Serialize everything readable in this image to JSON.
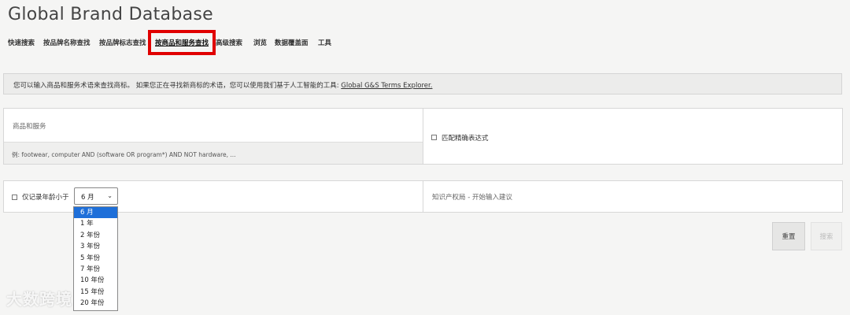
{
  "app_title": "Global Brand Database",
  "nav": {
    "items": [
      {
        "label": "快速搜索",
        "active": false
      },
      {
        "label": "按品牌名称查找",
        "active": false
      },
      {
        "label": "按品牌标志查找",
        "active": false
      },
      {
        "label": "按商品和服务查找",
        "active": true
      },
      {
        "label": "高级搜索",
        "active": false
      },
      {
        "label": "浏览",
        "active": false
      },
      {
        "label": "数据覆盖面",
        "active": false
      },
      {
        "label": "工具",
        "active": false
      }
    ]
  },
  "info": {
    "text": "您可以输入商品和服务术语来查找商标。 如果您正在寻找新商标的术语，您可以使用我们基于人工智能的工具: ",
    "link": "Global G&S Terms Explorer."
  },
  "form": {
    "gs_label": "商品和服务",
    "gs_placeholder": "例: footwear, computer AND (software OR program*) AND NOT hardware, ...",
    "exact_match_label": "匹配精确表达式",
    "age_label": "仅记录年龄小于",
    "age_selected": "6 月",
    "age_options": [
      "6 月",
      "1 年",
      "2 年份",
      "3 年份",
      "5 年份",
      "7 年份",
      "10 年份",
      "15 年份",
      "20 年份"
    ],
    "office_placeholder": "知识产权局 - 开始输入建议",
    "reset_label": "重置",
    "search_label": "搜索"
  },
  "watermark": "大数跨境",
  "colors": {
    "highlight": "#e00000",
    "selected_option": "#1e6fd9"
  }
}
